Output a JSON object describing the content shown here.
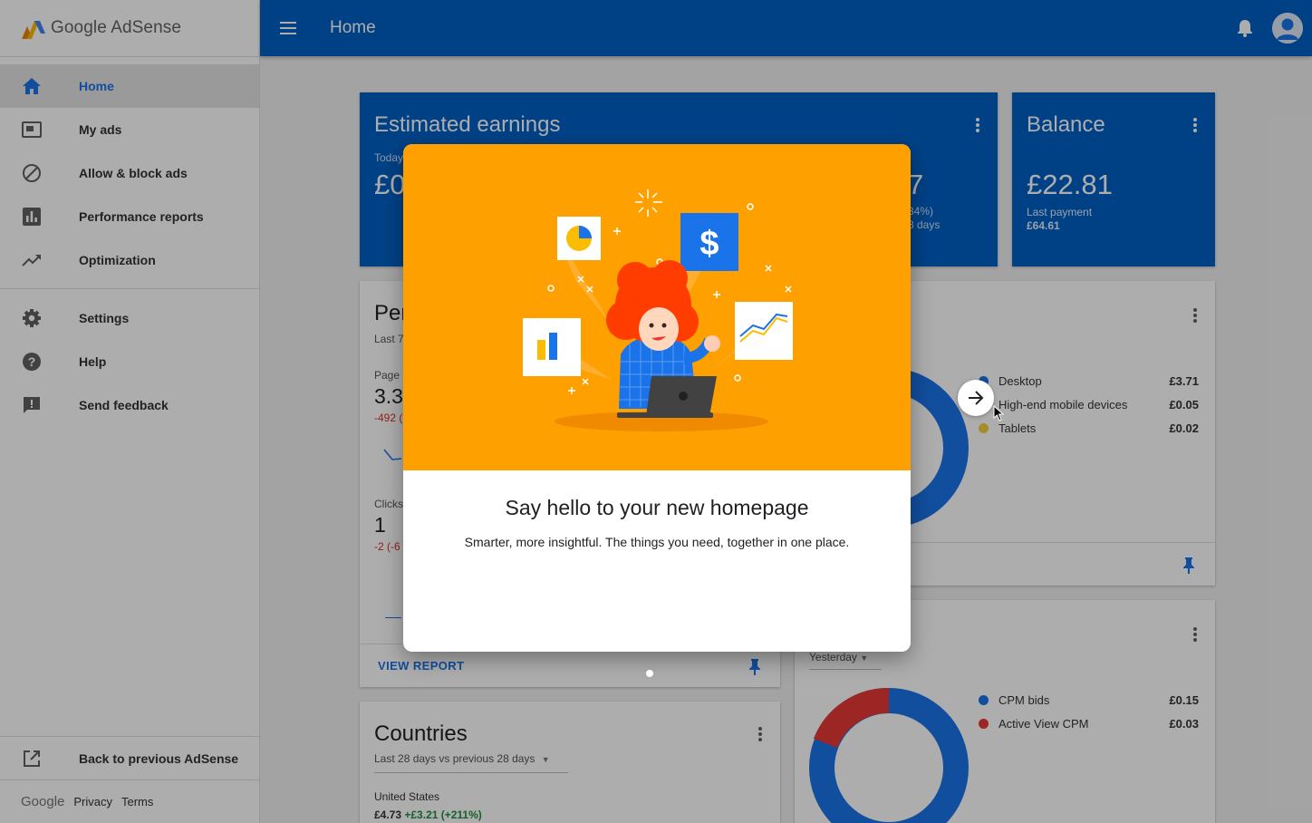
{
  "app": {
    "logo_google": "Google",
    "logo_product": "AdSense",
    "page_title": "Home"
  },
  "sidebar": {
    "items": [
      {
        "label": "Home",
        "icon": "home-icon"
      },
      {
        "label": "My ads",
        "icon": "ads-icon"
      },
      {
        "label": "Allow & block ads",
        "icon": "block-icon"
      },
      {
        "label": "Performance reports",
        "icon": "bar-chart-icon"
      },
      {
        "label": "Optimization",
        "icon": "trending-icon"
      },
      {
        "label": "Settings",
        "icon": "gear-icon"
      },
      {
        "label": "Help",
        "icon": "help-icon"
      },
      {
        "label": "Send feedback",
        "icon": "feedback-icon"
      }
    ],
    "back_label": "Back to previous AdSense",
    "footer": {
      "google": "Google",
      "privacy": "Privacy",
      "terms": "Terms"
    }
  },
  "cards": {
    "earnings": {
      "title": "Estimated earnings",
      "today_label": "Today",
      "today_value": "£0",
      "change_pct": "34%)",
      "change_period": "8 days",
      "partial_value": "7"
    },
    "balance": {
      "title": "Balance",
      "value": "£22.81",
      "last_payment_label": "Last payment",
      "last_payment_value": "£64.61"
    },
    "performance": {
      "title": "Per",
      "period": "Last 7",
      "page_label": "Page",
      "page_value": "3.3",
      "page_delta": "-492 (",
      "clicks_label": "Clicks",
      "clicks_value": "1",
      "clicks_delta": "-2 (-6",
      "view_report": "VIEW REPORT"
    },
    "platforms": {
      "legend": [
        {
          "name": "Desktop",
          "value": "£3.71",
          "color": "#1a73e8"
        },
        {
          "name": "High-end mobile devices",
          "value": "£0.05",
          "color": "#1a73e8"
        },
        {
          "name": "Tablets",
          "value": "£0.02",
          "color": "#f4d03f"
        }
      ]
    },
    "bid_types": {
      "period": "Yesterday",
      "legend": [
        {
          "name": "CPM bids",
          "value": "£0.15",
          "color": "#1a73e8"
        },
        {
          "name": "Active View CPM",
          "value": "£0.03",
          "color": "#e53935"
        }
      ]
    },
    "countries": {
      "title": "Countries",
      "period": "Last 28 days vs previous 28 days",
      "row_country": "United States",
      "row_value": "£4.73",
      "row_delta": "+£3.21 (+211%)"
    }
  },
  "modal": {
    "heading": "Say hello to your new homepage",
    "subtext": "Smarter, more insightful. The things you need, together in one place.",
    "dollar": "$"
  },
  "colors": {
    "brand_blue": "#0160c6",
    "modal_orange": "#fea100"
  }
}
